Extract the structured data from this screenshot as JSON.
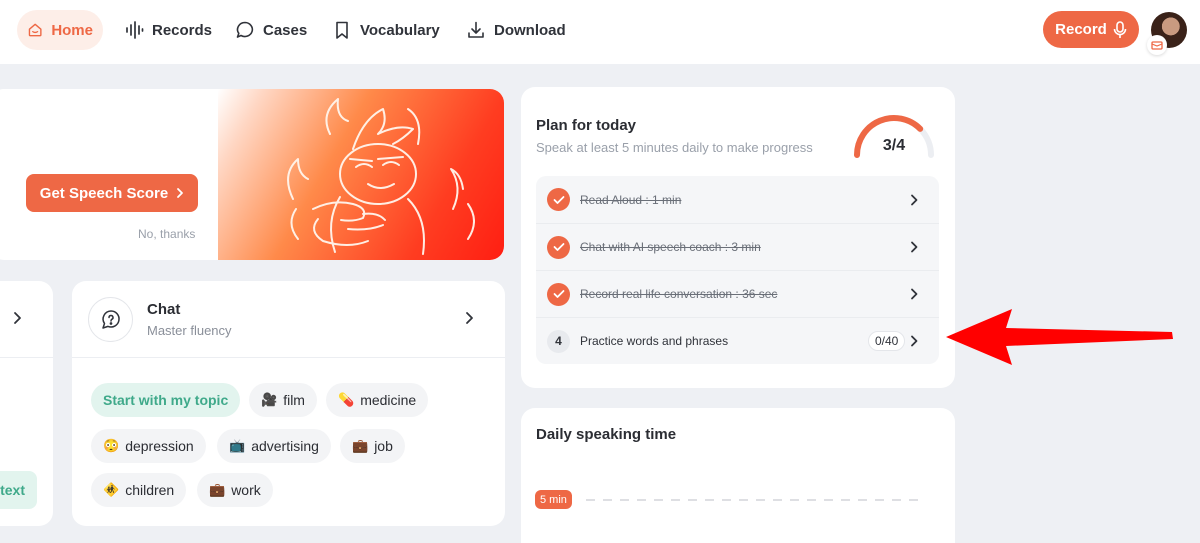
{
  "nav": {
    "home": "Home",
    "records": "Records",
    "cases": "Cases",
    "vocabulary": "Vocabulary",
    "download": "Download",
    "record_button": "Record"
  },
  "promo": {
    "button": "Get Speech Score",
    "dismiss": "No, thanks"
  },
  "left_card": {
    "pill": "text"
  },
  "chat": {
    "title": "Chat",
    "subtitle": "Master fluency",
    "topics": [
      {
        "label": "Start with my topic",
        "icon": ""
      },
      {
        "label": "film",
        "icon": "film-icon"
      },
      {
        "label": "medicine",
        "icon": "pill-icon"
      },
      {
        "label": "depression",
        "icon": "sad-face-icon"
      },
      {
        "label": "advertising",
        "icon": "tv-icon"
      },
      {
        "label": "job",
        "icon": "briefcase-icon"
      },
      {
        "label": "children",
        "icon": "children-crossing-icon"
      },
      {
        "label": "work",
        "icon": "briefcase-icon"
      }
    ]
  },
  "plan": {
    "title": "Plan for today",
    "subtitle": "Speak at least 5 minutes daily to make progress",
    "progress_label": "3/4",
    "progress_fraction": 0.75,
    "tasks": [
      {
        "label": "Read Aloud : 1 min",
        "done": true
      },
      {
        "label": "Chat with AI speech coach : 3 min",
        "done": true
      },
      {
        "label": "Record real life conversation : 36 sec",
        "done": true
      },
      {
        "label": "Practice words and phrases",
        "done": false,
        "number": "4",
        "count": "0/40"
      }
    ]
  },
  "daily": {
    "title": "Daily speaking time",
    "goal": "5 min"
  },
  "colors": {
    "accent": "#ee6845",
    "green": "#3fa98a",
    "annotation": "#ff0000"
  }
}
